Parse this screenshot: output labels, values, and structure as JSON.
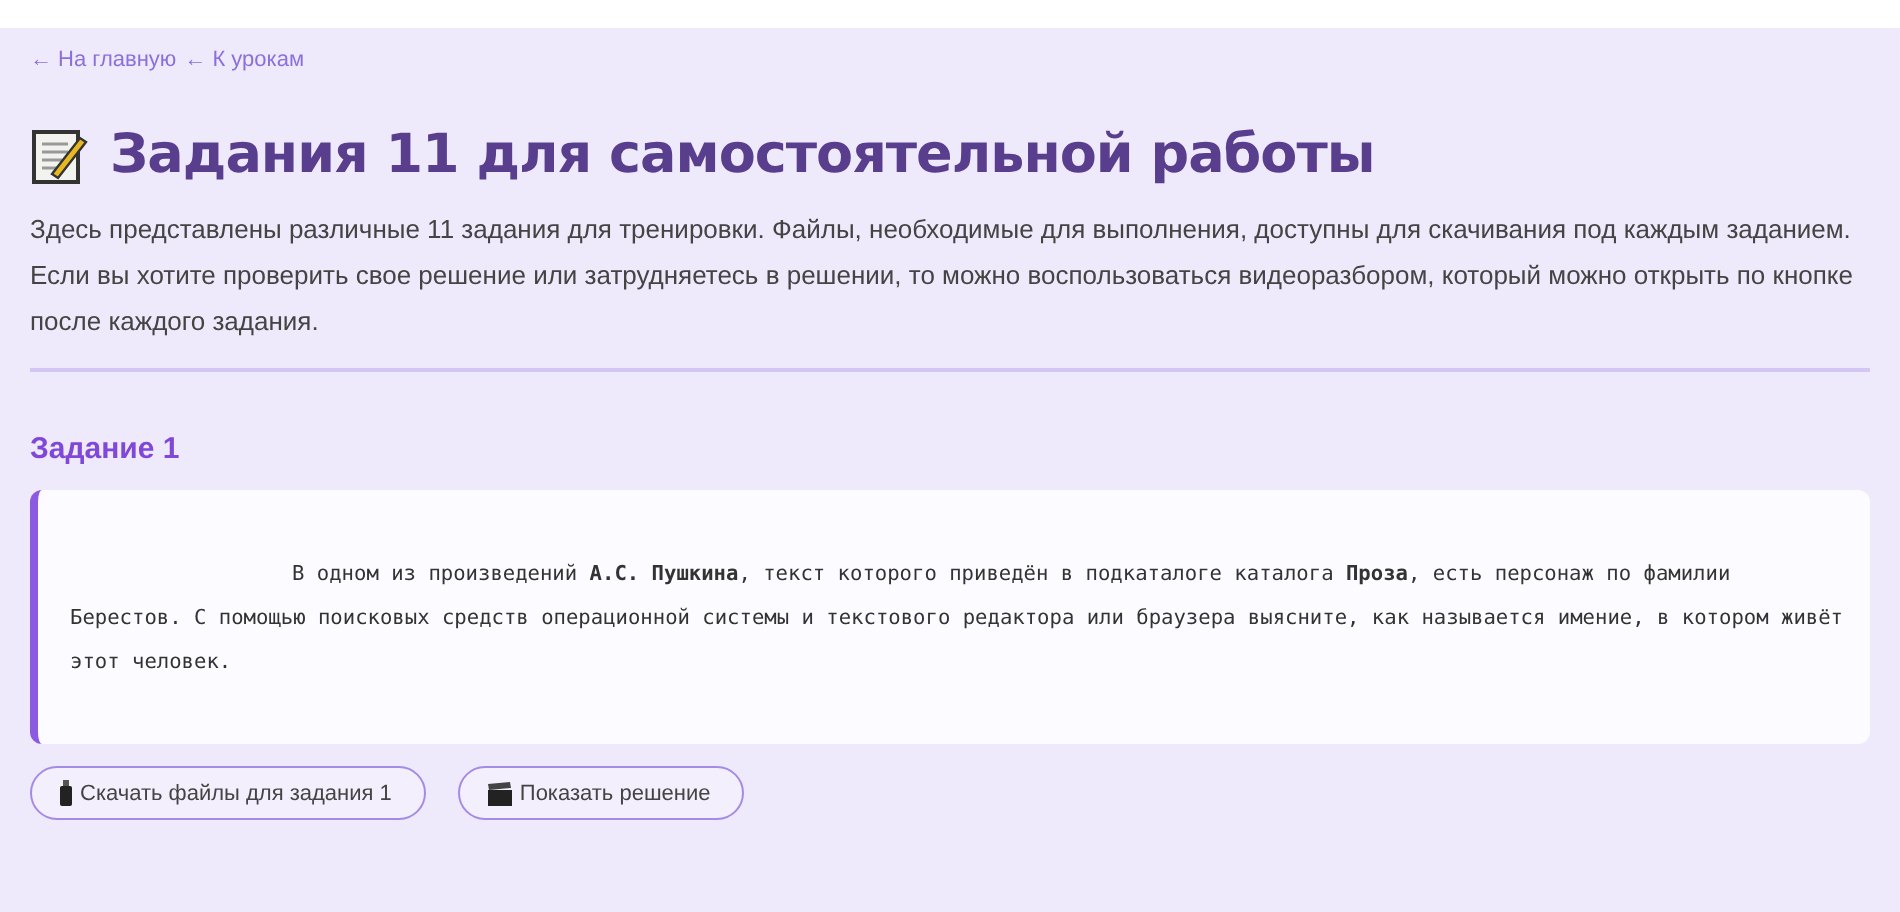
{
  "breadcrumbs": [
    {
      "label": "← На главную"
    },
    {
      "label": "← К урокам"
    }
  ],
  "title": "Задания 11 для самостоятельной работы",
  "intro": "Здесь представлены различные 11 задания для тренировки. Файлы, необходимые для выполнения, доступны для скачивания под каждым заданием. Если вы хотите проверить свое решение или затрудняетесь в решении, то можно воспользоваться видеоразбором, который можно открыть по кнопке после каждого задания.",
  "tasks": [
    {
      "heading": "Задание 1",
      "text": "В одном из произведений **А.С. Пушкина**, текст которого приведён в подкаталоге каталога **Проза**, есть персонаж по фамилии Берестов. С помощью поисковых средств операционной системы и текстового редактора или браузера выясните, как называется имение, в котором живёт этот человек.",
      "buttons": [
        {
          "kind": "download",
          "label": "Скачать файлы для задания 1"
        },
        {
          "kind": "solution",
          "label": "Показать решение"
        }
      ]
    }
  ]
}
